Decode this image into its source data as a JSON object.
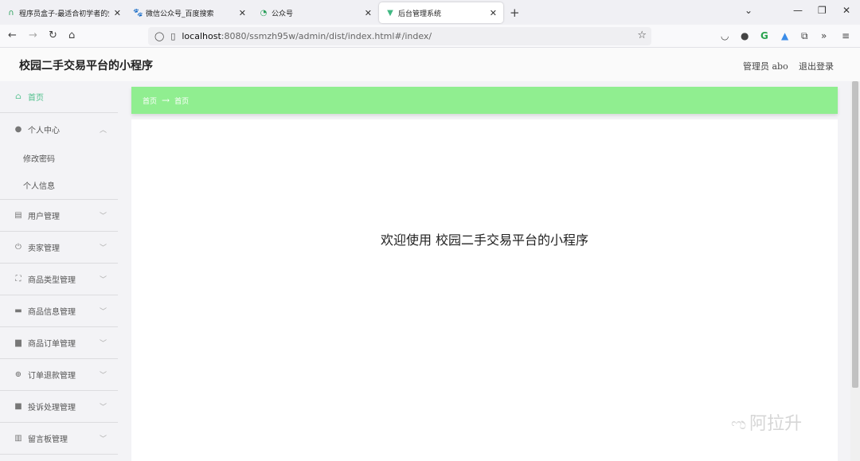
{
  "browser": {
    "tabs": [
      {
        "icon": "∩",
        "title": "程序员盒子-最适合初学者的免"
      },
      {
        "icon": "🐾",
        "title": "微信公众号_百度搜索"
      },
      {
        "icon": "◔",
        "title": "公众号"
      },
      {
        "icon": "▼",
        "title": "后台管理系统"
      }
    ],
    "url_host": "localhost",
    "url_path": ":8080/ssmzh95w/admin/dist/index.html#/index/"
  },
  "header": {
    "title": "校园二手交易平台的小程序",
    "user": "管理员 abo",
    "logout": "退出登录"
  },
  "sidebar": {
    "items": [
      {
        "label": "首页",
        "icon": "home-icon"
      },
      {
        "label": "个人中心",
        "icon": "user-icon"
      },
      {
        "label": "修改密码"
      },
      {
        "label": "个人信息"
      },
      {
        "label": "用户管理",
        "icon": "clipboard-icon"
      },
      {
        "label": "卖家管理",
        "icon": "power-icon"
      },
      {
        "label": "商品类型管理",
        "icon": "frame-icon"
      },
      {
        "label": "商品信息管理",
        "icon": "briefcase-icon"
      },
      {
        "label": "商品订单管理",
        "icon": "print-icon"
      },
      {
        "label": "订单退款管理",
        "icon": "target-icon"
      },
      {
        "label": "投诉处理管理",
        "icon": "video-icon"
      },
      {
        "label": "留言板管理",
        "icon": "chart-icon"
      }
    ]
  },
  "breadcrumb": {
    "first": "首页",
    "second": "首页"
  },
  "main": {
    "welcome": "欢迎使用 校园二手交易平台的小程序"
  },
  "watermark": "阿拉升",
  "colors": {
    "accent": "#50c08c",
    "breadcrumb_bg": "#90ee90"
  }
}
